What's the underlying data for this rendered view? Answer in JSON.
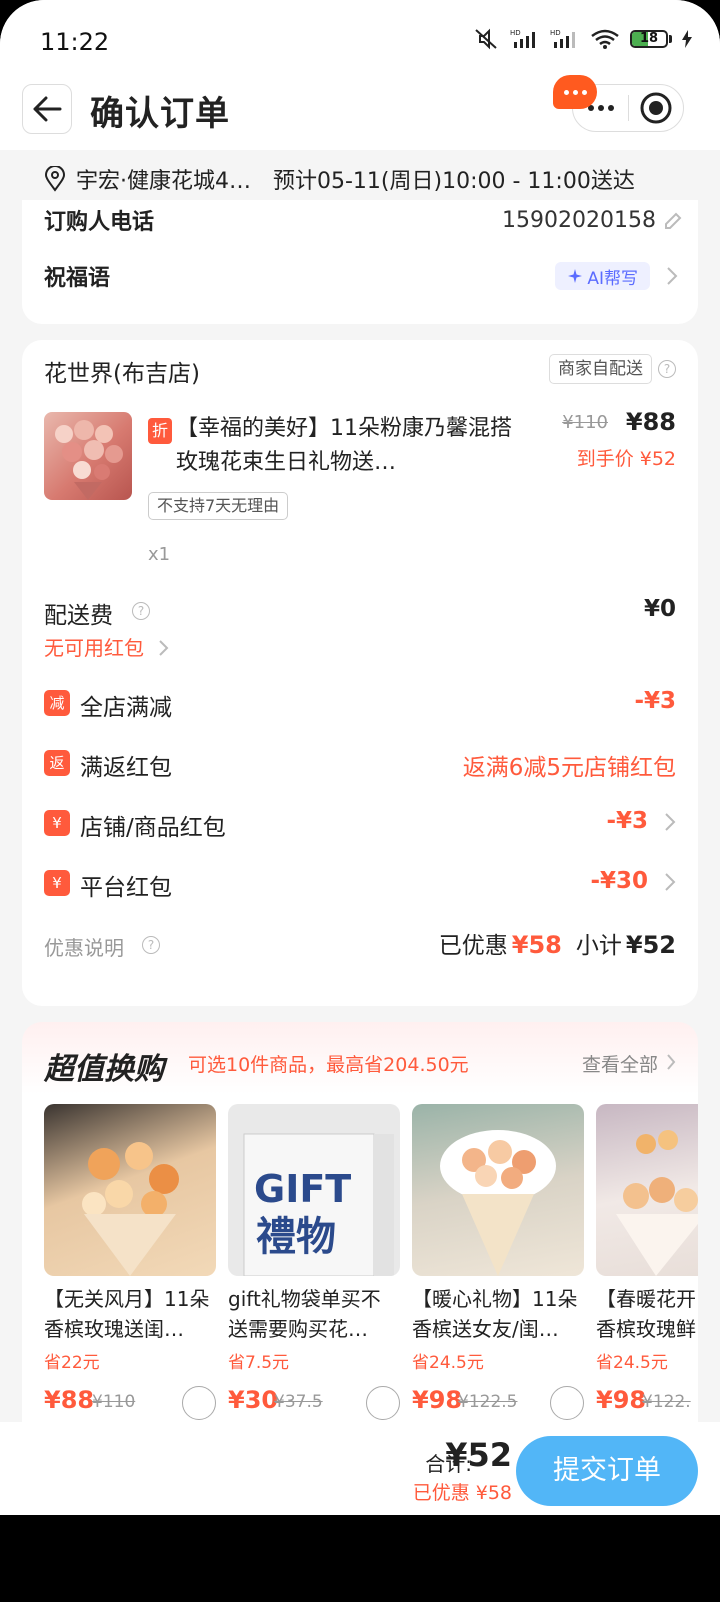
{
  "status_bar": {
    "time": "11:22",
    "battery": "18"
  },
  "header": {
    "title": "确认订单"
  },
  "address": {
    "text": "宇宏·健康花城4…",
    "delivery": "预计05-11(周日)10:00 - 11:00送达"
  },
  "order_info": {
    "phone_label": "订购人电话",
    "phone_value": "15902020158",
    "blessing_label": "祝福语",
    "ai_button": "AI帮写"
  },
  "shop": {
    "name": "花世界(布吉店)",
    "delivery_tag": "商家自配送",
    "product": {
      "discount_tag": "折",
      "title": "【幸福的美好】11朵粉康乃馨混搭玫瑰花束生日礼物送…",
      "original_price": "¥110",
      "price": "¥88",
      "final_price": "到手价 ¥52",
      "no_return": "不支持7天无理由",
      "quantity": "x1"
    },
    "delivery_fee_label": "配送费",
    "delivery_fee_value": "¥0",
    "no_redpack": "无可用红包",
    "promos": [
      {
        "icon": "减",
        "label": "全店满减",
        "value": "-¥3"
      },
      {
        "icon": "返",
        "label": "满返红包",
        "value": "返满6减5元店铺红包"
      },
      {
        "icon": "¥",
        "label": "店铺/商品红包",
        "value": "-¥3"
      },
      {
        "icon": "¥",
        "label": "平台红包",
        "value": "-¥30"
      }
    ],
    "discount_explain": "优惠说明",
    "summary_saved_label": "已优惠",
    "summary_saved_value": "¥58",
    "summary_subtotal_label": "小计",
    "summary_subtotal_value": "¥52"
  },
  "trade_up": {
    "title": "超值换购",
    "subtitle": "可选10件商品，最高省204.50元",
    "view_all": "查看全部",
    "items": [
      {
        "line1": "【无关风月】11朵",
        "line2": "香槟玫瑰送闺…",
        "save": "省22元",
        "price": "¥88",
        "orig": "¥110"
      },
      {
        "line1": "gift礼物袋单买不",
        "line2": "送需要购买花…",
        "save": "省7.5元",
        "price": "¥30",
        "orig": "¥37.5",
        "img_text1": "GIFT",
        "img_text2": "禮物"
      },
      {
        "line1": "【暖心礼物】11朵",
        "line2": "香槟送女友/闺…",
        "save": "省24.5元",
        "price": "¥98",
        "orig": "¥122.5"
      },
      {
        "line1": "【春暖花开",
        "line2": "香槟玫瑰鲜",
        "save": "省24.5元",
        "price": "¥98",
        "orig": "¥122."
      }
    ]
  },
  "bottom": {
    "total_label": "合计:",
    "total_value": "¥52",
    "saved": "已优惠 ¥58",
    "submit": "提交订单"
  },
  "colors": {
    "accent": "#ff5a3c",
    "submit": "#52b6f7",
    "ai": "#5b6cff"
  }
}
